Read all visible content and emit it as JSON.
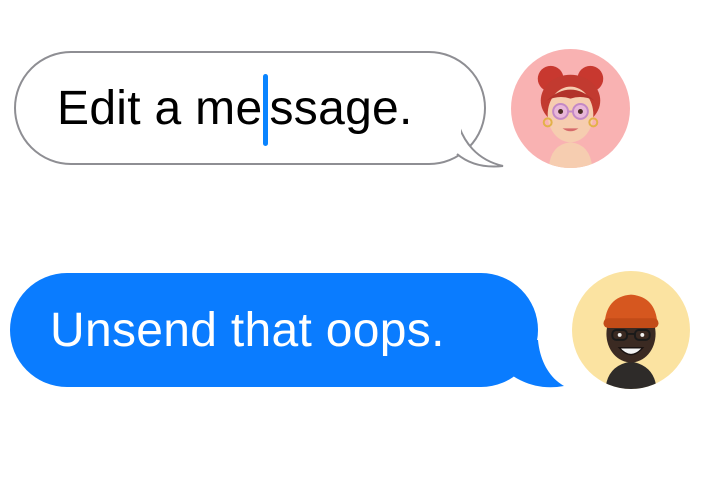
{
  "messages": [
    {
      "text_before_caret": "Edit a me",
      "text_after_caret": "ssage.",
      "state": "editing",
      "avatar_icon": "memoji-red-buns-avatar-icon",
      "avatar_bg": "#f9b2b2"
    },
    {
      "text": "Unsend that oops.",
      "state": "sent",
      "avatar_icon": "memoji-orange-beanie-avatar-icon",
      "avatar_bg": "#fbe3a1"
    }
  ],
  "colors": {
    "sent_bubble": "#0a7cff",
    "caret": "#0a84ff",
    "outline": "#8e8e93"
  }
}
